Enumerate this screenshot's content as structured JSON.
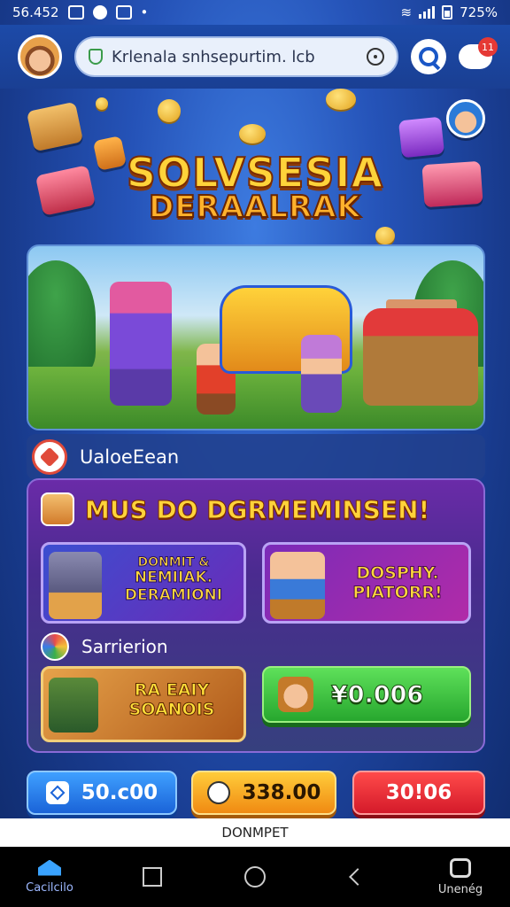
{
  "status_bar": {
    "time": "56.452",
    "battery": "725%"
  },
  "header": {
    "search_value": "Krlenala snhsepurtim. lcb",
    "notification_count": "11"
  },
  "hero": {
    "logo_line1": "SOLVSESIA",
    "logo_line2": "DERAALRAK"
  },
  "section": {
    "label": "UaloeEean"
  },
  "panel": {
    "title": "MUS DO DGRMEMINSEN!",
    "card1": {
      "line1": "DONMIT &",
      "line2": "NEMIIAK.",
      "line3": "DERAMIONI"
    },
    "card2": {
      "line1": "DOSPHY.",
      "line2": "PIATORR!"
    },
    "subsection_label": "Sarrierion",
    "card3": {
      "line1": "RA EAIY",
      "line2": "SOANOIS"
    },
    "green_button": "¥0.006"
  },
  "bottom_buttons": {
    "blue": "50.c00",
    "orange": "338.00",
    "red": "30!06"
  },
  "ad_bar": {
    "text": "DONMPET"
  },
  "nav": {
    "left_label": "Cacilcilo",
    "right_label": "Unenég"
  },
  "colors": {
    "accent_blue": "#1a63d8",
    "accent_orange": "#f08a12",
    "accent_red": "#d41a2a",
    "accent_green": "#27a72e",
    "panel_purple": "#6a2ba8"
  }
}
